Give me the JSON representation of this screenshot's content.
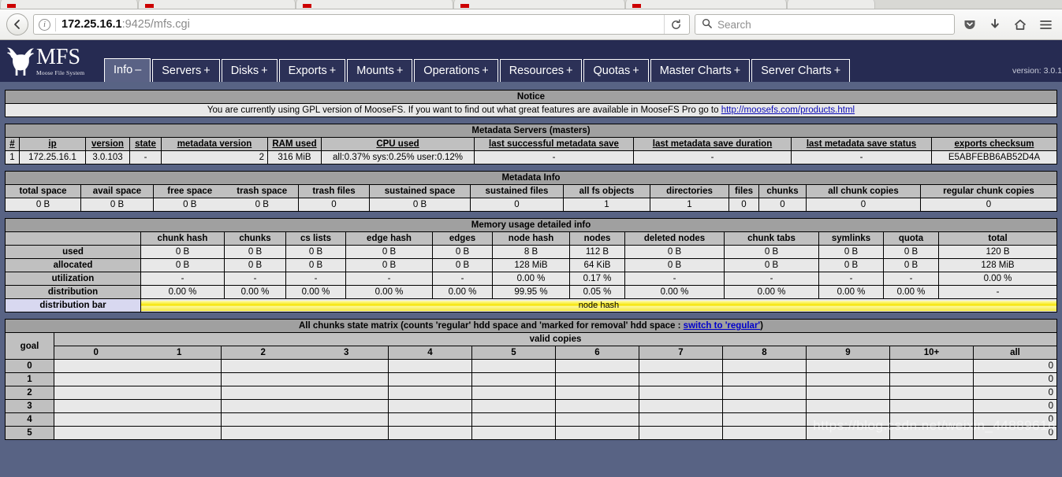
{
  "browser": {
    "back_icon": "back-arrow-icon",
    "identity_icon": "info-icon",
    "url_host": "172.25.16.1",
    "url_rest": ":9425/mfs.cgi",
    "reload_icon": "reload-icon",
    "search_placeholder": "Search",
    "search_icon": "search-icon",
    "pocket_icon": "pocket-icon",
    "downloads_icon": "downloads-icon",
    "home_icon": "home-icon",
    "menu_icon": "hamburger-menu-icon"
  },
  "header": {
    "logo_word": "MFS",
    "logo_sub": "Moose File System",
    "version": "version: 3.0.1",
    "tabs": [
      {
        "label": "Info",
        "pm": "–",
        "active": true
      },
      {
        "label": "Servers",
        "pm": "+",
        "active": false
      },
      {
        "label": "Disks",
        "pm": "+",
        "active": false
      },
      {
        "label": "Exports",
        "pm": "+",
        "active": false
      },
      {
        "label": "Mounts",
        "pm": "+",
        "active": false
      },
      {
        "label": "Operations",
        "pm": "+",
        "active": false
      },
      {
        "label": "Resources",
        "pm": "+",
        "active": false
      },
      {
        "label": "Quotas",
        "pm": "+",
        "active": false
      },
      {
        "label": "Master Charts",
        "pm": "+",
        "active": false
      },
      {
        "label": "Server Charts",
        "pm": "+",
        "active": false
      }
    ]
  },
  "notice": {
    "title": "Notice",
    "text_before": "You are currently using GPL version of MooseFS. If you want to find out what great features are available in MooseFS Pro go to ",
    "link": "http://moosefs.com/products.html"
  },
  "masters": {
    "title": "Metadata Servers (masters)",
    "columns": [
      "#",
      "ip",
      "version",
      "state",
      "metadata version",
      "RAM used",
      "CPU used",
      "last successful metadata save",
      "last metadata save duration",
      "last metadata save status",
      "exports checksum"
    ],
    "rows": [
      {
        "num": "1",
        "ip": "172.25.16.1",
        "version": "3.0.103",
        "state": "-",
        "metadata_version": "2",
        "ram_used": "316 MiB",
        "cpu_used": "all:0.37% sys:0.25% user:0.12%",
        "last_save": "-",
        "save_duration": "-",
        "save_status": "-",
        "exports_checksum": "E5ABFEBB6AB52D4A"
      }
    ]
  },
  "metadata_info": {
    "title": "Metadata Info",
    "columns": [
      "total space",
      "avail space",
      "free space",
      "trash space",
      "trash files",
      "sustained space",
      "sustained files",
      "all fs objects",
      "directories",
      "files",
      "chunks",
      "all chunk copies",
      "regular chunk copies"
    ],
    "values": [
      "0 B",
      "0 B",
      "0 B",
      "0 B",
      "0",
      "0 B",
      "0",
      "1",
      "1",
      "0",
      "0",
      "0",
      "0"
    ]
  },
  "memory_usage": {
    "title": "Memory usage detailed info",
    "columns": [
      "chunk hash",
      "chunks",
      "cs lists",
      "edge hash",
      "edges",
      "node hash",
      "nodes",
      "deleted nodes",
      "chunk tabs",
      "symlinks",
      "quota",
      "total"
    ],
    "rows": [
      {
        "label": "used",
        "values": [
          "0 B",
          "0 B",
          "0 B",
          "0 B",
          "0 B",
          "8 B",
          "112 B",
          "0 B",
          "0 B",
          "0 B",
          "0 B",
          "120 B"
        ]
      },
      {
        "label": "allocated",
        "values": [
          "0 B",
          "0 B",
          "0 B",
          "0 B",
          "0 B",
          "128 MiB",
          "64 KiB",
          "0 B",
          "0 B",
          "0 B",
          "0 B",
          "128 MiB"
        ]
      },
      {
        "label": "utilization",
        "values": [
          "-",
          "-",
          "-",
          "-",
          "-",
          "0.00 %",
          "0.17 %",
          "-",
          "-",
          "-",
          "-",
          "0.00 %"
        ]
      },
      {
        "label": "distribution",
        "values": [
          "0.00 %",
          "0.00 %",
          "0.00 %",
          "0.00 %",
          "0.00 %",
          "99.95 %",
          "0.05 %",
          "0.00 %",
          "0.00 %",
          "0.00 %",
          "0.00 %",
          "-"
        ]
      }
    ],
    "distribution_bar_label": "distribution bar",
    "distribution_bar_segment": "node hash",
    "distribution_bar_color": "#f5e400"
  },
  "chunk_matrix": {
    "title_before": "All chunks state matrix (counts 'regular' hdd space and 'marked for removal' hdd space : ",
    "title_link": "switch to 'regular'",
    "title_after": ")",
    "goal_label": "goal",
    "valid_copies_label": "valid copies",
    "columns": [
      "0",
      "1",
      "2",
      "3",
      "4",
      "5",
      "6",
      "7",
      "8",
      "9",
      "10+",
      "all"
    ],
    "rows": [
      {
        "goal": "0",
        "values": [
          "",
          "",
          "",
          "",
          "",
          "",
          "",
          "",
          "",
          "",
          "",
          "0"
        ]
      },
      {
        "goal": "1",
        "values": [
          "",
          "",
          "",
          "",
          "",
          "",
          "",
          "",
          "",
          "",
          "",
          "0"
        ]
      },
      {
        "goal": "2",
        "values": [
          "",
          "",
          "",
          "",
          "",
          "",
          "",
          "",
          "",
          "",
          "",
          "0"
        ]
      },
      {
        "goal": "3",
        "values": [
          "",
          "",
          "",
          "",
          "",
          "",
          "",
          "",
          "",
          "",
          "",
          "0"
        ]
      },
      {
        "goal": "4",
        "values": [
          "",
          "",
          "",
          "",
          "",
          "",
          "",
          "",
          "",
          "",
          "",
          "0"
        ]
      },
      {
        "goal": "5",
        "values": [
          "",
          "",
          "",
          "",
          "",
          "",
          "",
          "",
          "",
          "",
          "",
          "0"
        ]
      }
    ]
  },
  "watermark": "https://blog.csdn.net/weixin_44889616"
}
